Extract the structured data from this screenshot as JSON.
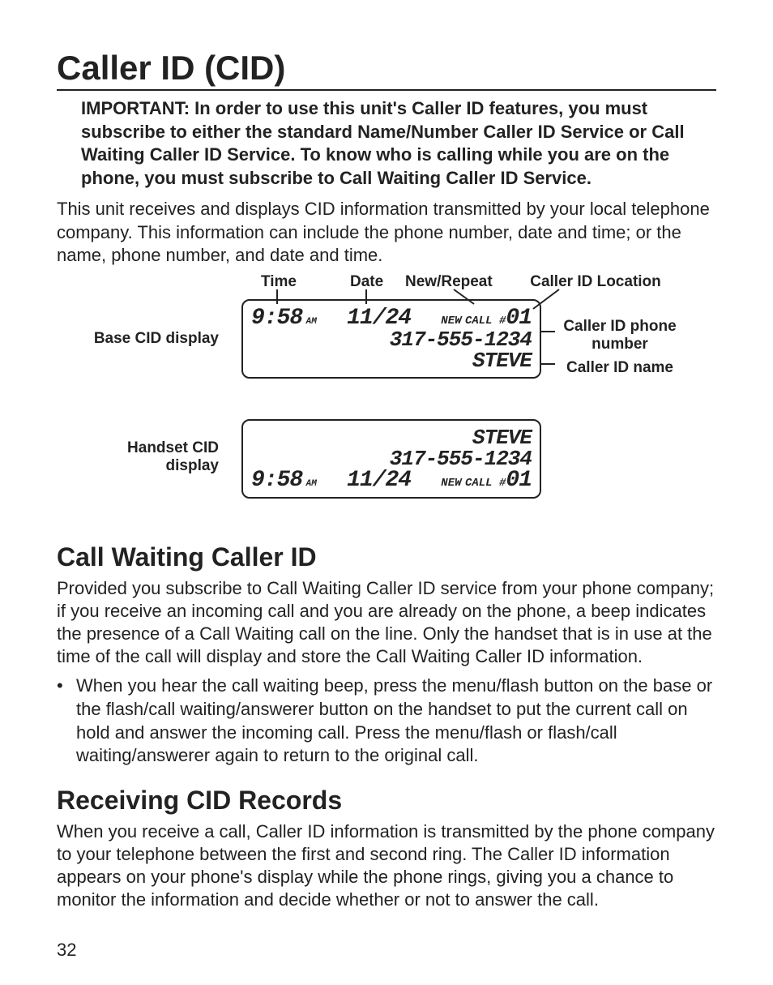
{
  "title": "Caller ID (CID)",
  "important": "IMPORTANT: In order to use this unit's Caller ID features, you must subscribe to either the standard Name/Number Caller ID Service or Call Waiting Caller ID Service. To know who is calling while you are on the phone, you must subscribe to Call Waiting Caller ID Service.",
  "intro": "This unit receives and displays CID information transmitted by your local telephone company. This information can include the phone number, date and time; or the name, phone number, and date and time.",
  "diagram": {
    "headers": {
      "time": "Time",
      "date": "Date",
      "new_repeat": "New/Repeat",
      "location": "Caller ID Location"
    },
    "side_labels": {
      "base": "Base CID display",
      "handset": "Handset CID display"
    },
    "right_labels": {
      "phone": "Caller ID phone number",
      "name": "Caller ID name"
    },
    "lcd": {
      "time": "9:58",
      "ampm": "AM",
      "date": "11/24",
      "new": "NEW",
      "call": "CALL #",
      "loc": "01",
      "number": "317-555-1234",
      "name": "STEVE"
    }
  },
  "sections": {
    "cwcid": {
      "title": "Call Waiting Caller ID",
      "body": "Provided you subscribe to Call Waiting Caller ID service from your phone company; if you receive an incoming call and you are already on the phone, a beep indicates the presence of a Call Waiting call on the line. Only the handset that is in use at the time of the call will display and store the Call Waiting Caller ID information.",
      "bullet": "When you hear the call waiting beep, press the menu/flash button on the base or the flash/call waiting/answerer button on the handset to put the current call on hold and answer the incoming call. Press the menu/flash or flash/call waiting/answerer again to return to the original call."
    },
    "receiving": {
      "title": "Receiving CID Records",
      "body": "When you receive a call, Caller ID information is transmitted by the phone company to your telephone between the first and second ring. The Caller ID information appears on your phone's display while the phone rings, giving you a chance to monitor the information and decide whether or not to answer the call."
    }
  },
  "page_number": "32"
}
